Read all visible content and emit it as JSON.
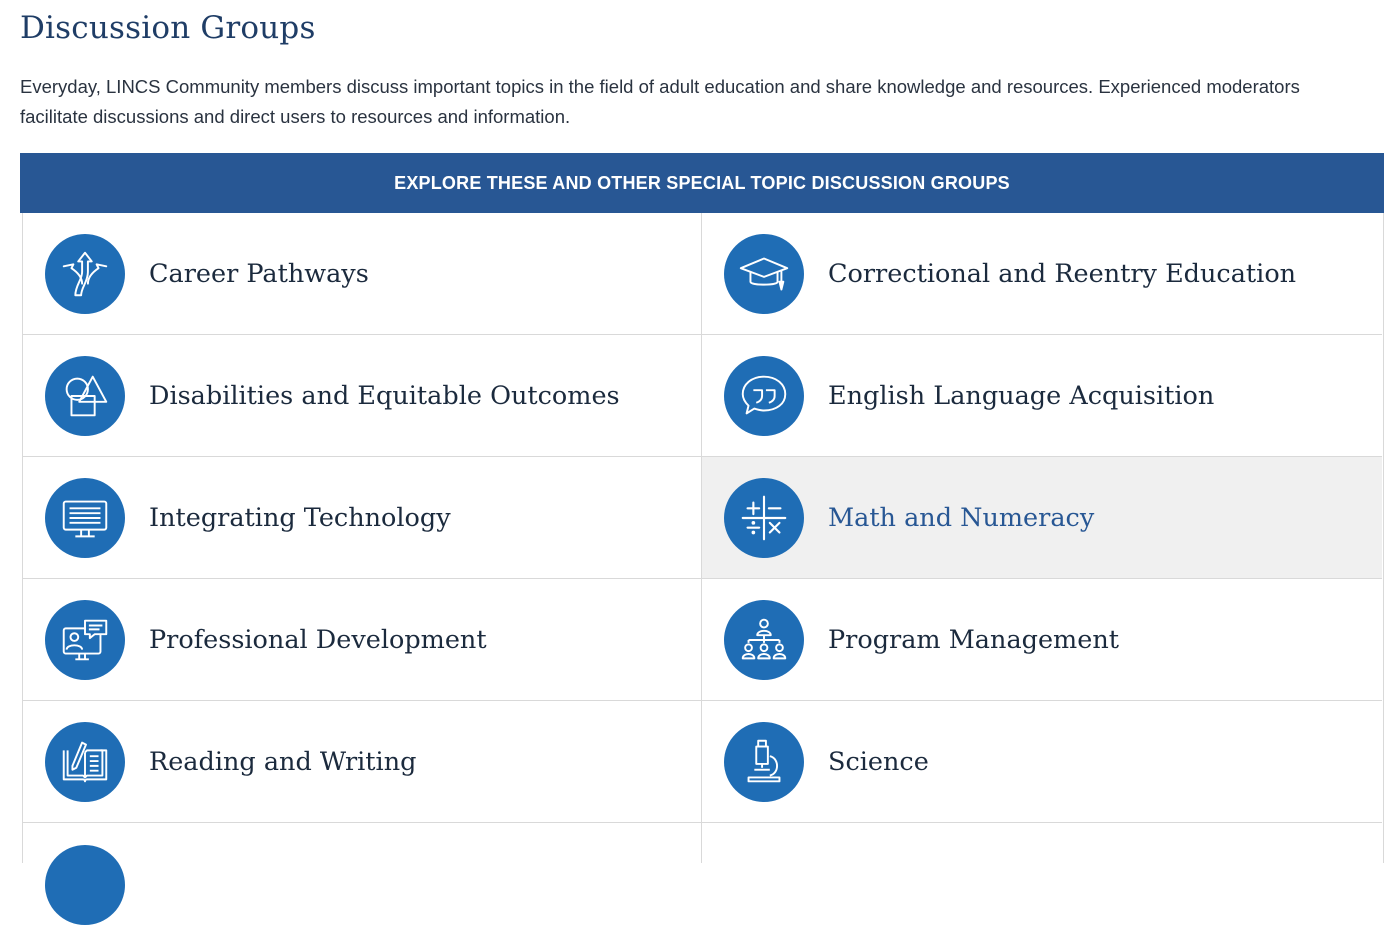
{
  "page": {
    "title": "Discussion Groups",
    "intro": "Everyday, LINCS Community members discuss important topics in the field of adult education and share knowledge and resources. Experienced moderators facilitate discussions and direct users to resources and information.",
    "banner": "EXPLORE THESE AND OTHER SPECIAL TOPIC DISCUSSION GROUPS"
  },
  "groups": [
    {
      "label": "Career Pathways",
      "icon": "career-pathways-icon"
    },
    {
      "label": "Correctional and Reentry Education",
      "icon": "graduation-cap-icon"
    },
    {
      "label": "Disabilities and Equitable Outcomes",
      "icon": "shapes-icon"
    },
    {
      "label": "English Language Acquisition",
      "icon": "speech-bubble-quote-icon"
    },
    {
      "label": "Integrating Technology",
      "icon": "monitor-icon"
    },
    {
      "label": "Math and Numeracy",
      "icon": "math-operators-icon",
      "state": "hover"
    },
    {
      "label": "Professional Development",
      "icon": "video-conference-icon"
    },
    {
      "label": "Program Management",
      "icon": "org-chart-people-icon"
    },
    {
      "label": "Reading and Writing",
      "icon": "book-pencil-icon"
    },
    {
      "label": "Science",
      "icon": "microscope-icon"
    }
  ],
  "colors": {
    "banner": "#285794",
    "icon_circle": "#1f6db5",
    "hover_background": "#f0f0f0",
    "title": "#1f3d66"
  }
}
